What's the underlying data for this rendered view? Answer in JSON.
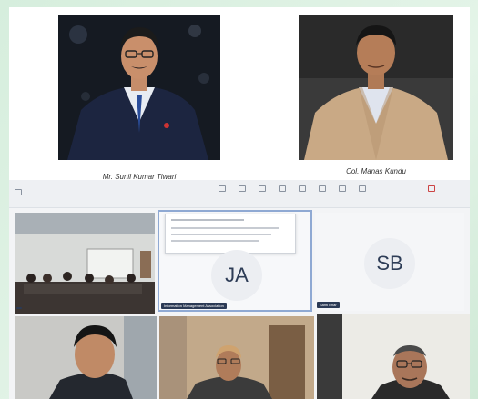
{
  "photos": [
    {
      "caption": "Mr. Sunil Kumar Tiwari"
    },
    {
      "caption": "Col. Manas Kundu"
    }
  ],
  "meeting": {
    "participants": [
      {
        "initials": "JA",
        "name_tag": "Information Management Association"
      },
      {
        "initials": "SB",
        "name_tag": "Santi Bhar"
      }
    ]
  },
  "colors": {
    "background": "#d9efe0",
    "avatar_text": "#2e3d57",
    "name_tag_bg": "#2b3a55"
  }
}
